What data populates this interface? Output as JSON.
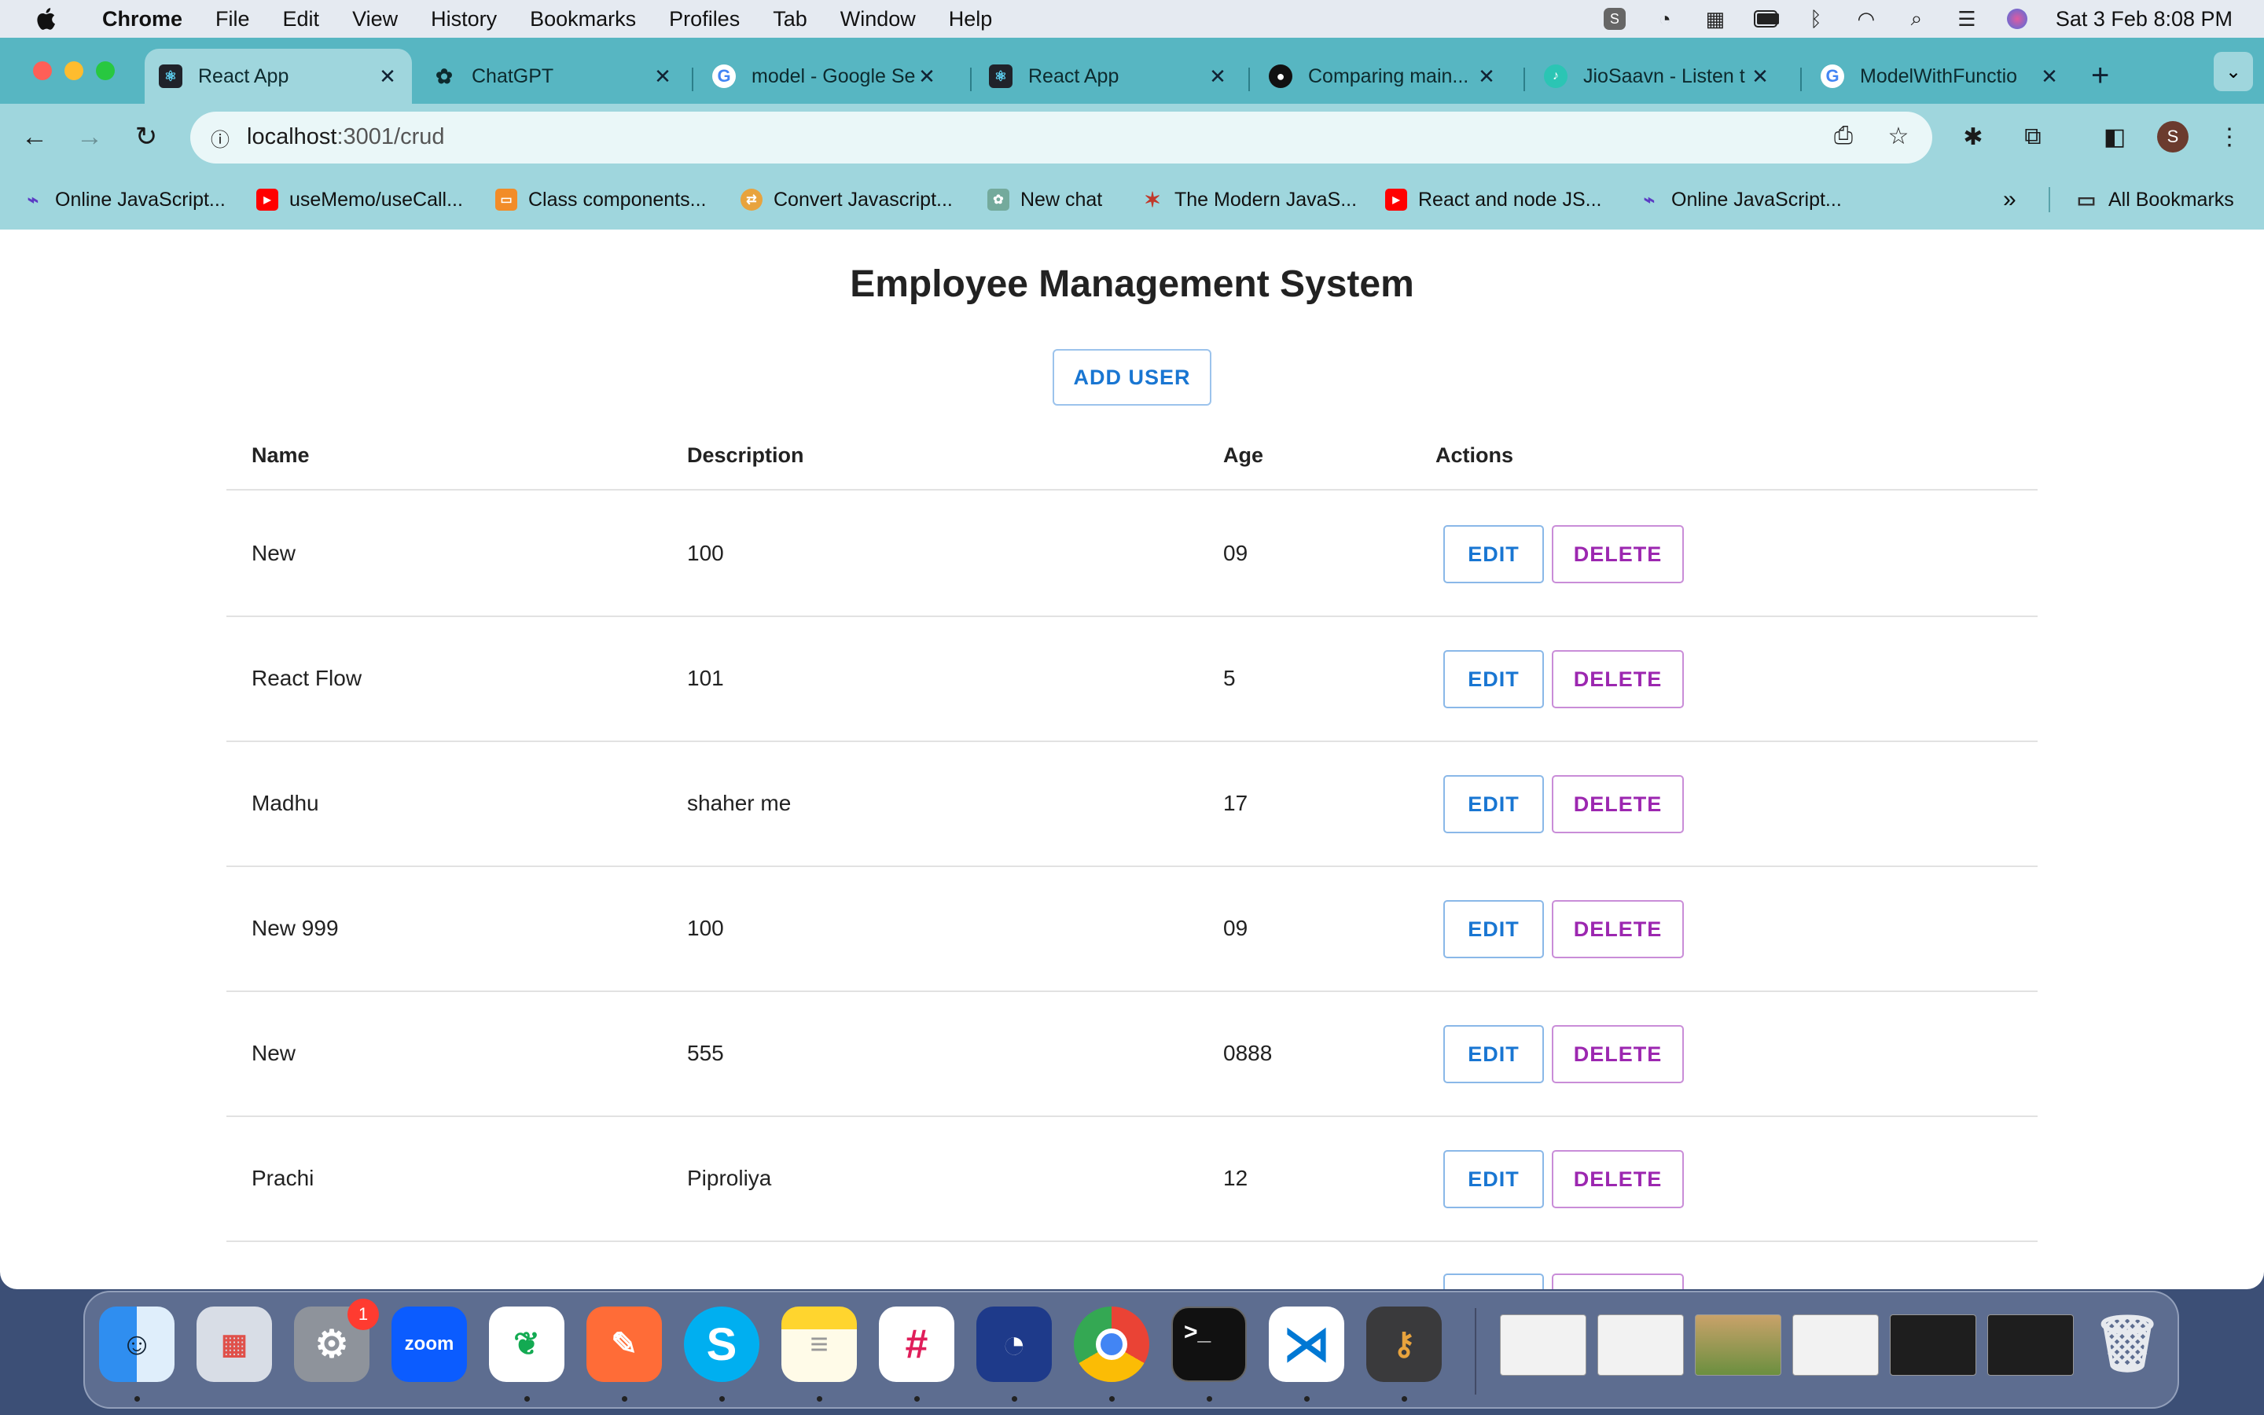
{
  "menubar": {
    "app_name": "Chrome",
    "items": [
      "File",
      "Edit",
      "View",
      "History",
      "Bookmarks",
      "Profiles",
      "Tab",
      "Window",
      "Help"
    ],
    "datetime": "Sat 3 Feb  8:08 PM"
  },
  "tabs": [
    {
      "title": "React App",
      "icon": "react-icon"
    },
    {
      "title": "ChatGPT",
      "icon": "chatgpt-icon"
    },
    {
      "title": "model - Google Se",
      "icon": "google-icon"
    },
    {
      "title": "React App",
      "icon": "react-icon"
    },
    {
      "title": "Comparing main...",
      "icon": "github-icon"
    },
    {
      "title": "JioSaavn - Listen t",
      "icon": "jiosaavn-icon"
    },
    {
      "title": "ModelWithFunctio",
      "icon": "google-icon"
    }
  ],
  "address_bar": {
    "host": "localhost",
    "path": ":3001/crud"
  },
  "profile_initial": "S",
  "bookmarks": [
    {
      "label": "Online JavaScript...",
      "icon": "programiz-icon"
    },
    {
      "label": "useMemo/useCall...",
      "icon": "youtube-icon"
    },
    {
      "label": "Class components...",
      "icon": "codesandbox-icon"
    },
    {
      "label": "Convert Javascript...",
      "icon": "converter-icon"
    },
    {
      "label": "New chat",
      "icon": "chatgpt-icon"
    },
    {
      "label": "The Modern JavaS...",
      "icon": "javascript-info-icon"
    },
    {
      "label": "React and node JS...",
      "icon": "youtube-icon"
    },
    {
      "label": "Online JavaScript...",
      "icon": "programiz-icon"
    }
  ],
  "all_bookmarks_label": "All Bookmarks",
  "app": {
    "title": "Employee Management System",
    "add_user_label": "ADD USER",
    "columns": [
      "Name",
      "Description",
      "Age",
      "Actions"
    ],
    "edit_label": "EDIT",
    "delete_label": "DELETE",
    "rows": [
      {
        "name": "New",
        "description": "100",
        "age": "09"
      },
      {
        "name": "React Flow",
        "description": "101",
        "age": "5"
      },
      {
        "name": "Madhu",
        "description": "shaher me",
        "age": "17"
      },
      {
        "name": "New 999",
        "description": "100",
        "age": "09"
      },
      {
        "name": "New",
        "description": "555",
        "age": "0888"
      },
      {
        "name": "Prachi",
        "description": "Piproliya",
        "age": "12"
      }
    ]
  },
  "dock": {
    "apps": [
      "finder",
      "launchpad",
      "system-settings",
      "zoom",
      "mongodb-compass",
      "postman",
      "skype",
      "notes",
      "slack",
      "proxyman",
      "google-chrome",
      "terminal",
      "vscode",
      "keychain-access"
    ],
    "zoom_label": "zoom",
    "settings_badge": "1"
  }
}
